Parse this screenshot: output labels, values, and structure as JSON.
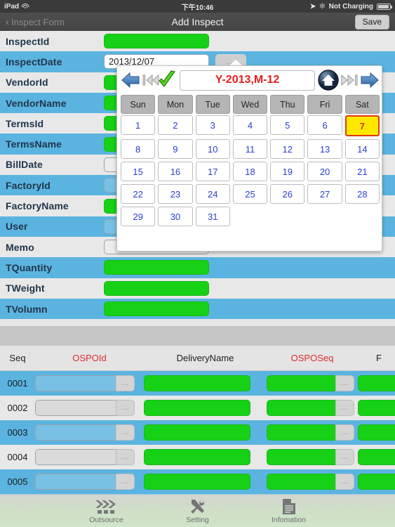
{
  "status_bar": {
    "device": "iPad",
    "wifi_icon": "wifi-icon",
    "time": "下午10:46",
    "location_icon": "location-arrow-icon",
    "bluetooth_icon": "bluetooth-icon",
    "battery_text": "Not Charging",
    "battery_icon": "battery-icon"
  },
  "nav_bar": {
    "back_label": "Inspect Form",
    "back_icon": "chevron-left-icon",
    "title": "Add Inspect",
    "save_label": "Save"
  },
  "form": {
    "rows": [
      {
        "label": "InspectId",
        "type": "green",
        "value": ""
      },
      {
        "label": "InspectDate",
        "type": "text",
        "value": "2013/12/07",
        "has_dots": true,
        "dots_label": "..."
      },
      {
        "label": "VendorId",
        "type": "green",
        "value": ""
      },
      {
        "label": "VendorName",
        "type": "green",
        "value": ""
      },
      {
        "label": "TermsId",
        "type": "green",
        "value": ""
      },
      {
        "label": "TermsName",
        "type": "green",
        "value": ""
      },
      {
        "label": "BillDate",
        "type": "plain",
        "value": ""
      },
      {
        "label": "FactoryId",
        "type": "plain",
        "value": ""
      },
      {
        "label": "FactoryName",
        "type": "green",
        "value": ""
      },
      {
        "label": "User",
        "type": "plain",
        "value": ""
      },
      {
        "label": "Memo",
        "type": "plain",
        "value": ""
      },
      {
        "label": "TQuantity",
        "type": "green",
        "value": ""
      },
      {
        "label": "TWeight",
        "type": "green",
        "value": ""
      },
      {
        "label": "TVolumn",
        "type": "green",
        "value": ""
      }
    ]
  },
  "calendar": {
    "month_label": "Y-2013,M-12",
    "prev_icon": "arrow-left-icon",
    "prev_year_icon": "skip-back-icon",
    "confirm_icon": "check-icon",
    "home_icon": "home-icon",
    "next_year_icon": "skip-forward-icon",
    "next_icon": "arrow-right-icon",
    "weekdays": [
      "Sun",
      "Mon",
      "Tue",
      "Wed",
      "Thu",
      "Fri",
      "Sat"
    ],
    "days": [
      "1",
      "2",
      "3",
      "4",
      "5",
      "6",
      "7",
      "8",
      "9",
      "10",
      "11",
      "12",
      "13",
      "14",
      "15",
      "16",
      "17",
      "18",
      "19",
      "20",
      "21",
      "22",
      "23",
      "24",
      "25",
      "26",
      "27",
      "28",
      "29",
      "30",
      "31"
    ],
    "selected_day": "7",
    "accent_month_color": "#e02020",
    "selected_bg": "#ffe800",
    "selected_border": "#e03a10"
  },
  "table": {
    "headers": [
      {
        "label": "Seq",
        "color": "black"
      },
      {
        "label": "OSPOId",
        "color": "red"
      },
      {
        "label": "DeliveryName",
        "color": "black"
      },
      {
        "label": "OSPOSeq",
        "color": "red"
      },
      {
        "label": "F",
        "color": "black"
      }
    ],
    "rows": [
      {
        "seq": "0001",
        "ospoid": "",
        "ospoid_dots": "...",
        "delivery": "",
        "osposeq": "",
        "osposeq_dots": "...",
        "last": ""
      },
      {
        "seq": "0002",
        "ospoid": "",
        "ospoid_dots": "...",
        "delivery": "",
        "osposeq": "",
        "osposeq_dots": "...",
        "last": ""
      },
      {
        "seq": "0003",
        "ospoid": "",
        "ospoid_dots": "...",
        "delivery": "",
        "osposeq": "",
        "osposeq_dots": "...",
        "last": ""
      },
      {
        "seq": "0004",
        "ospoid": "",
        "ospoid_dots": "...",
        "delivery": "",
        "osposeq": "",
        "osposeq_dots": "...",
        "last": ""
      },
      {
        "seq": "0005",
        "ospoid": "",
        "ospoid_dots": "...",
        "delivery": "",
        "osposeq": "",
        "osposeq_dots": "...",
        "last": ""
      }
    ]
  },
  "tab_bar": {
    "tabs": [
      {
        "label": "Outsource",
        "icon": "chevrons-right-icon"
      },
      {
        "label": "Setting",
        "icon": "hammer-wrench-icon"
      },
      {
        "label": "Infomation",
        "icon": "document-icon"
      }
    ]
  },
  "colors": {
    "row_highlight": "#5bb4e0",
    "row_plain": "#e8e8e8",
    "field_green": "#16d116",
    "label_text": "#20354b"
  }
}
